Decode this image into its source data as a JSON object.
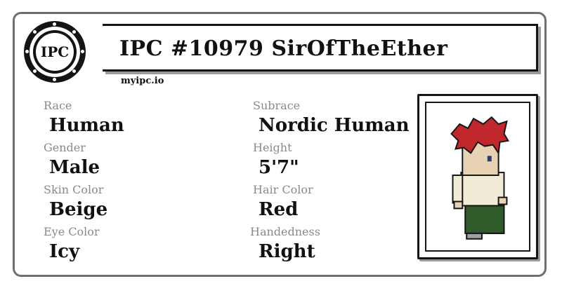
{
  "header": {
    "title": "IPC #10979 SirOfTheEther",
    "site": "myipc.io",
    "seal_text": "IPC"
  },
  "attributes": [
    {
      "label": "Race",
      "value": "Human"
    },
    {
      "label": "Subrace",
      "value": "Nordic Human"
    },
    {
      "label": "Gender",
      "value": "Male"
    },
    {
      "label": "Height",
      "value": "5'7\""
    },
    {
      "label": "Skin Color",
      "value": "Beige"
    },
    {
      "label": "Hair Color",
      "value": "Red"
    },
    {
      "label": "Eye Color",
      "value": "Icy"
    },
    {
      "label": "Handedness",
      "value": "Right"
    }
  ],
  "colors": {
    "border": "#6f6f6f",
    "ink": "#141414",
    "label": "#8a8a8a",
    "hair": "#c0282c",
    "skin": "#e8d2b4",
    "shirt": "#f2ecd6",
    "pants": "#2f5a2a",
    "shoes": "#9aa0a6"
  },
  "portrait": {
    "icon": "character-portrait"
  }
}
